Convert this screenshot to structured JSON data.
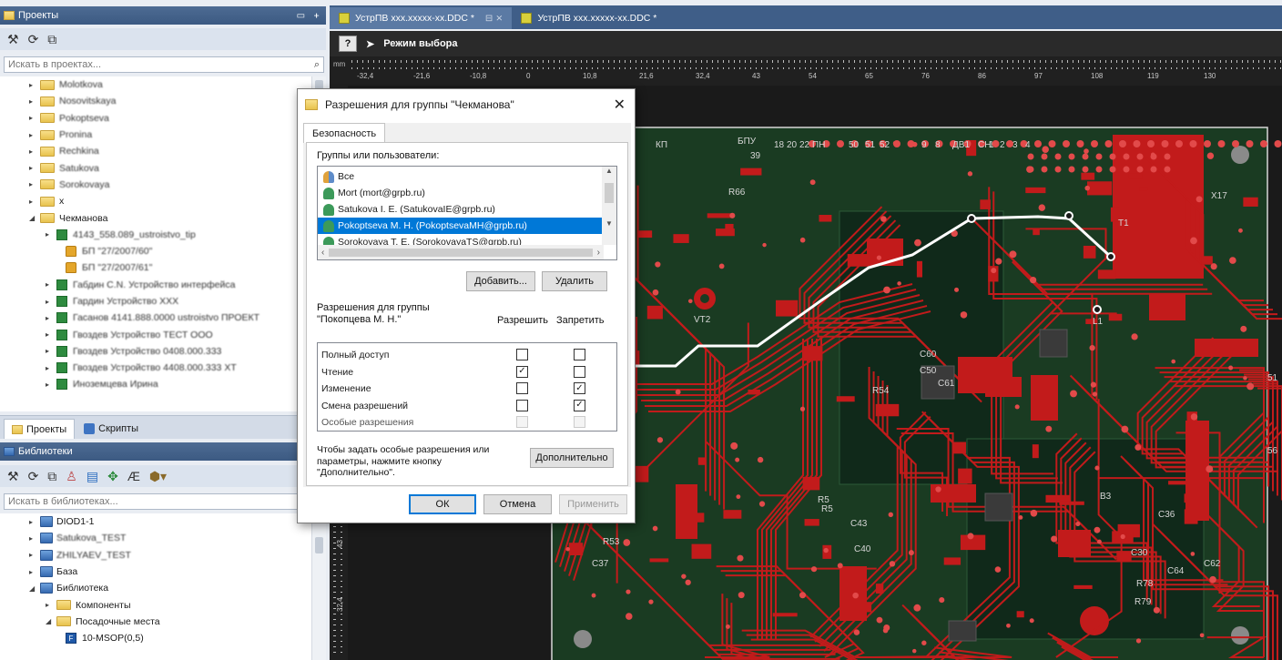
{
  "projects_panel": {
    "title": "Проекты",
    "controls": [
      "▭",
      "ᚐ"
    ],
    "search_placeholder": "Искать в проектах...",
    "tree": [
      {
        "label": "Molotkova",
        "level": 0,
        "icon": "folder",
        "blurred": true
      },
      {
        "label": "Nosovitskaya",
        "level": 0,
        "icon": "folder",
        "blurred": true
      },
      {
        "label": "Pokoptseva",
        "level": 0,
        "icon": "folder",
        "blurred": true
      },
      {
        "label": "Pronina",
        "level": 0,
        "icon": "folder",
        "blurred": true
      },
      {
        "label": "Rechkina",
        "level": 0,
        "icon": "folder",
        "blurred": true
      },
      {
        "label": "Satukova",
        "level": 0,
        "icon": "folder",
        "blurred": true
      },
      {
        "label": "Sorokovaya",
        "level": 0,
        "icon": "folder",
        "blurred": true
      },
      {
        "label": "x",
        "level": 0,
        "icon": "folder",
        "blurred": false
      },
      {
        "label": "Чекманова",
        "level": 0,
        "icon": "folder",
        "blurred": false,
        "expanded": true
      },
      {
        "label": "4143_558.089_ustroistvo_tip",
        "level": 1,
        "icon": "project",
        "blurred": true
      },
      {
        "label": "БП \"27/2007/60\"",
        "level": 2,
        "icon": "lock",
        "blurred": true
      },
      {
        "label": "БП \"27/2007/61\"",
        "level": 2,
        "icon": "lock",
        "blurred": true
      },
      {
        "label": "Габдин С.N. Устройство интерфейса",
        "level": 1,
        "icon": "project",
        "blurred": true
      },
      {
        "label": "Гардин Устройство ХХХ",
        "level": 1,
        "icon": "project",
        "blurred": true
      },
      {
        "label": "Гасанов 4141.888.0000 ustroistvo ПРОЕКТ",
        "level": 1,
        "icon": "project",
        "blurred": true
      },
      {
        "label": "Гвоздев Устройство ТЕСТ ООО",
        "level": 1,
        "icon": "project",
        "blurred": true
      },
      {
        "label": "Гвоздев Устройство 0408.000.333",
        "level": 1,
        "icon": "project",
        "blurred": true
      },
      {
        "label": "Гвоздев Устройство 4408.000.333 XT",
        "level": 1,
        "icon": "project",
        "blurred": true
      },
      {
        "label": "Иноземцева Ирина",
        "level": 1,
        "icon": "project",
        "blurred": true
      }
    ]
  },
  "bottom_tabs": [
    {
      "label": "Проекты",
      "active": true
    },
    {
      "label": "Скрипты",
      "active": false
    }
  ],
  "libraries_panel": {
    "title": "Библиотеки",
    "search_placeholder": "Искать в библиотеках...",
    "tree": [
      {
        "label": "DIOD1-1",
        "level": 0,
        "icon": "library",
        "arrow": "▸",
        "blurred": false
      },
      {
        "label": "Satukova_TEST",
        "level": 0,
        "icon": "library",
        "arrow": "▸",
        "blurred": true
      },
      {
        "label": "ZHILYAEV_TEST",
        "level": 0,
        "icon": "library",
        "arrow": "▸",
        "blurred": true
      },
      {
        "label": "База",
        "level": 0,
        "icon": "library",
        "arrow": "▸",
        "blurred": false
      },
      {
        "label": "Библиотека",
        "level": 0,
        "icon": "library",
        "arrow": "◢",
        "blurred": false
      },
      {
        "label": "Компоненты",
        "level": 1,
        "icon": "folder",
        "arrow": "▸",
        "blurred": false
      },
      {
        "label": "Посадочные места",
        "level": 1,
        "icon": "folder",
        "arrow": "◢",
        "blurred": false
      },
      {
        "label": "10-MSOP(0,5)",
        "level": 2,
        "icon": "footprint",
        "arrow": "",
        "blurred": false
      }
    ]
  },
  "document_tabs": [
    {
      "label": "УстрПВ xxx.xxxxx-xx.DDC *",
      "active": true,
      "controls": "⊟ ⨯"
    },
    {
      "label": "УстрПВ xxx.xxxxx-xx.DDC *",
      "active": false,
      "controls": ""
    }
  ],
  "mode_bar": {
    "help": "?",
    "mode": "Режим выбора"
  },
  "ruler": {
    "unit": "mm",
    "top_ticks": [
      "-32,4",
      "-21,6",
      "-10,8",
      "0",
      "10,8",
      "21,6",
      "32,4",
      "43",
      "54",
      "65",
      "76",
      "86",
      "97",
      "108",
      "119",
      "130"
    ],
    "left_ticks": [
      "43",
      "32,4"
    ]
  },
  "pcb_labels": [
    "КП",
    "БПУ",
    "18",
    "20",
    "22",
    "ПН",
    "50",
    "51",
    "52",
    "9",
    "8",
    "ДВ1",
    "СН",
    "1",
    "2",
    "3",
    "4",
    "X17",
    "T1",
    "R66",
    "VT2",
    "C60",
    "C50",
    "C61",
    "R54",
    "R5",
    "C43",
    "C40",
    "C36",
    "C30",
    "B3",
    "R78",
    "R79",
    "C64",
    "C62",
    "51",
    "56",
    "R53",
    "C37",
    "R5",
    "L1",
    "39"
  ],
  "dialog": {
    "title": "Разрешения для группы \"Чекманова\"",
    "tab": "Безопасность",
    "groups_label": "Группы или пользователи:",
    "users": [
      {
        "label": "Все",
        "icon": "group",
        "selected": false
      },
      {
        "label": "Mort (mort@grpb.ru)",
        "icon": "person",
        "selected": false
      },
      {
        "label": "Satukova I. E. (SatukovaIE@grpb.ru)",
        "icon": "person",
        "selected": false
      },
      {
        "label": "Pokoptseva M. H. (PokoptsevaMH@grpb.ru)",
        "icon": "person",
        "selected": true
      },
      {
        "label": "Sorokovaya T. E. (SorokovayaTS@grpb.ru)",
        "icon": "person",
        "selected": false
      }
    ],
    "add_button": "Добавить...",
    "remove_button": "Удалить",
    "permissions_label": "Разрешения для группы \"Покопцева М. Н.\"",
    "allow_header": "Разрешить",
    "deny_header": "Запретить",
    "permissions": [
      {
        "name": "Полный доступ",
        "allow": false,
        "deny": false,
        "disabled": false
      },
      {
        "name": "Чтение",
        "allow": true,
        "deny": false,
        "disabled": false
      },
      {
        "name": "Изменение",
        "allow": false,
        "deny": true,
        "disabled": false
      },
      {
        "name": "Смена разрешений",
        "allow": false,
        "deny": true,
        "disabled": false
      },
      {
        "name": "Особые разрешения",
        "allow": false,
        "deny": false,
        "disabled": true
      }
    ],
    "advanced_hint": "Чтобы задать особые разрешения или параметры, нажмите кнопку \"Дополнительно\".",
    "advanced_button": "Дополнительно",
    "ok_button": "ОК",
    "cancel_button": "Отмена",
    "apply_button": "Применить"
  },
  "colors": {
    "panel_header": "#3c5a82",
    "board": "#1a3b22",
    "copper": "#c21b1b",
    "pad": "#e24a4a",
    "selection": "#0078d7"
  }
}
